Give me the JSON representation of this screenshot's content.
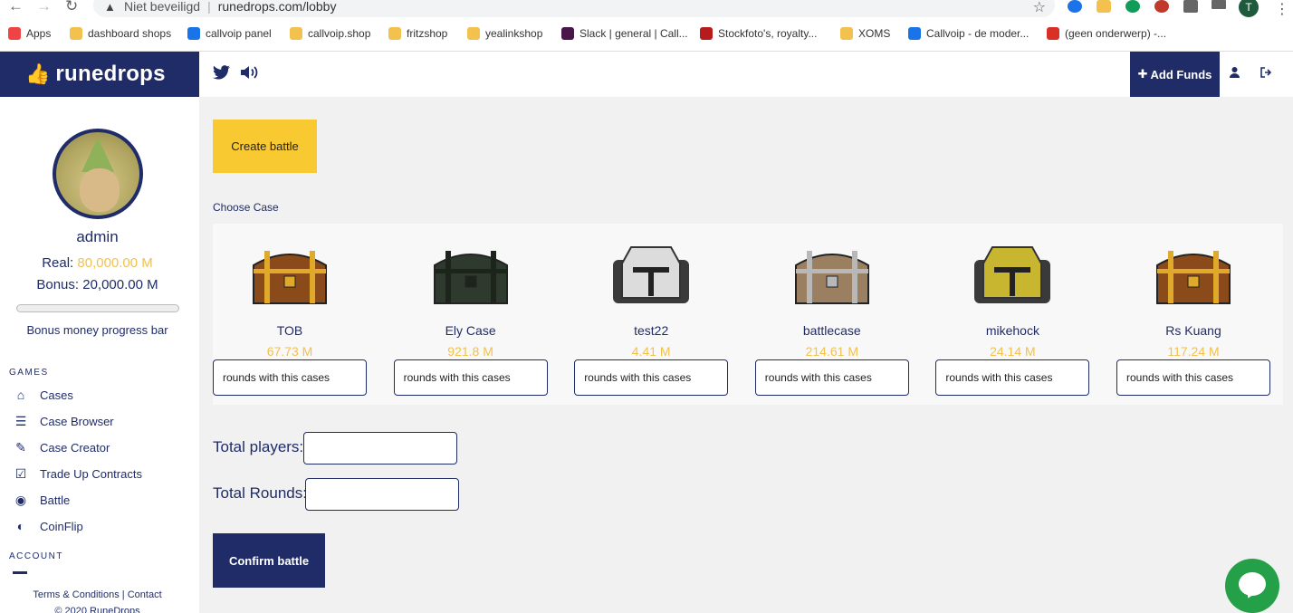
{
  "browser": {
    "security_text": "Niet beveiligd",
    "url": "runedrops.com/lobby",
    "profile_initial": "T",
    "bookmarks": [
      {
        "label": "Apps",
        "color": "#e44"
      },
      {
        "label": "dashboard shops",
        "color": "#f2c14e"
      },
      {
        "label": "callvoip panel",
        "color": "#1a73e8"
      },
      {
        "label": "callvoip.shop",
        "color": "#f2c14e"
      },
      {
        "label": "fritzshop",
        "color": "#f2c14e"
      },
      {
        "label": "yealinkshop",
        "color": "#f2c14e"
      },
      {
        "label": "Slack | general | Call...",
        "color": "#4a154b"
      },
      {
        "label": "Stockfoto's, royalty...",
        "color": "#b71c1c"
      },
      {
        "label": "XOMS",
        "color": "#f2c14e"
      },
      {
        "label": "Callvoip - de moder...",
        "color": "#1a73e8"
      },
      {
        "label": "(geen onderwerp) -...",
        "color": "#d93025"
      }
    ]
  },
  "header": {
    "logo_text": "runedrops",
    "add_funds": "Add Funds",
    "add_funds_icon": "plus-icon"
  },
  "sidebar": {
    "username": "admin",
    "real_label": "Real:",
    "real_value": "80,000.00 M",
    "bonus_label": "Bonus:",
    "bonus_value": "20,000.00 M",
    "progress_fraction": 0,
    "progress_label": "Bonus money progress bar",
    "games_title": "GAMES",
    "games": [
      {
        "label": "Cases",
        "icon": "home-icon"
      },
      {
        "label": "Case Browser",
        "icon": "list-icon"
      },
      {
        "label": "Case Creator",
        "icon": "edit-icon"
      },
      {
        "label": "Trade Up Contracts",
        "icon": "checkbox-icon"
      },
      {
        "label": "Battle",
        "icon": "gamepad-icon"
      },
      {
        "label": "CoinFlip",
        "icon": "half-circle-icon"
      }
    ],
    "account_title": "ACCOUNT",
    "footer_terms": "Terms & Conditions",
    "footer_contact": "Contact",
    "copyright": "© 2020 RuneDrops"
  },
  "main": {
    "create_battle": "Create battle",
    "choose_case": "Choose Case",
    "rounds_placeholder": "rounds with this cases",
    "cases": [
      {
        "name": "TOB",
        "price": "67.73 M",
        "style": "gold"
      },
      {
        "name": "Ely Case",
        "price": "921.8 M",
        "style": "dark"
      },
      {
        "name": "test22",
        "price": "4.41 M",
        "style": "helm-silver"
      },
      {
        "name": "battlecase",
        "price": "214.61 M",
        "style": "silver"
      },
      {
        "name": "mikehock",
        "price": "24.14 M",
        "style": "helm-gold"
      },
      {
        "name": "Rs Kuang",
        "price": "117.24 M",
        "style": "gold"
      }
    ],
    "total_players_label": "Total players:",
    "total_rounds_label": "Total Rounds:",
    "confirm_battle": "Confirm battle"
  },
  "colors": {
    "navy": "#1f2c68",
    "gold": "#f2c14e",
    "create_button": "#f8c930",
    "chat_green": "#24a148"
  }
}
